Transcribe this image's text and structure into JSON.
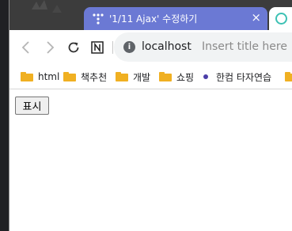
{
  "tab": {
    "title": "'1/11 Ajax' 수정하기",
    "close_label": "×",
    "favicon": "trello-dots-icon"
  },
  "tab2": {
    "favicon": "loading-ring-icon"
  },
  "toolbar": {
    "back_icon": "chevron-left-icon",
    "forward_icon": "chevron-right-icon",
    "reload_icon": "reload-icon",
    "notion_icon": "notion-icon",
    "info_icon": "i",
    "host": "localhost",
    "title_placeholder": "Insert title here"
  },
  "bookmarks": [
    {
      "label": "html",
      "icon": "folder-icon"
    },
    {
      "label": "책추천",
      "icon": "folder-icon"
    },
    {
      "label": "개발",
      "icon": "folder-icon"
    },
    {
      "label": "쇼핑",
      "icon": "folder-icon"
    },
    {
      "label": "한컴 타자연습",
      "icon": "dot-icon"
    }
  ],
  "page": {
    "button_label": "표시"
  },
  "colors": {
    "tab_active": "#6b79d4",
    "tab_strip": "#3c3c3c",
    "folder": "#f0b022",
    "ring": "#3dc1b4"
  }
}
